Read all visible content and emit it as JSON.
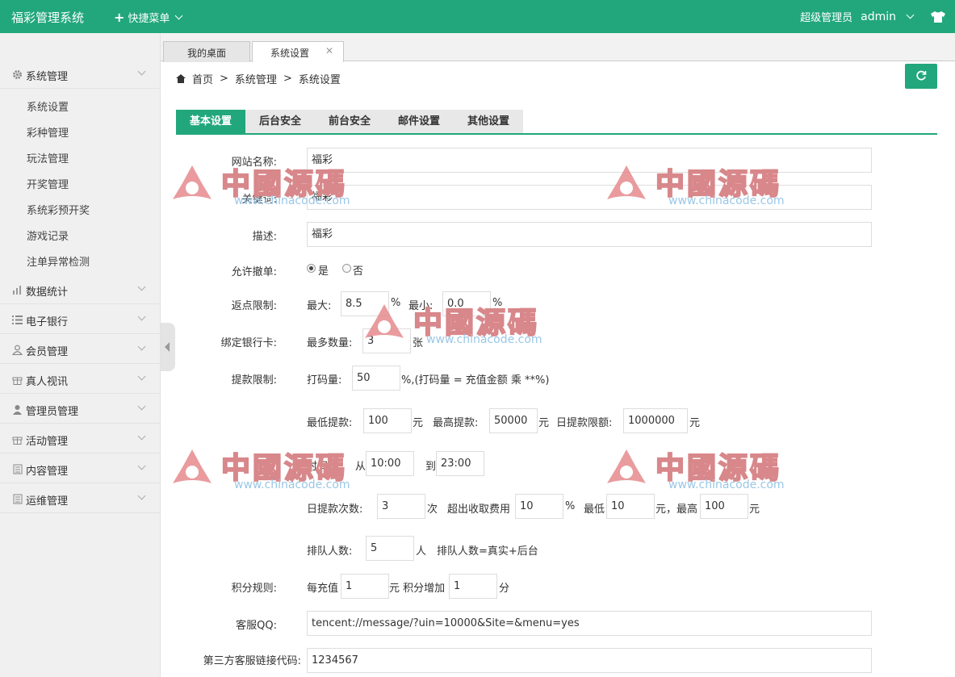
{
  "header": {
    "brand": "福彩管理系统",
    "quick_menu": "快捷菜单",
    "role": "超级管理员",
    "user": "admin",
    "theme_icon": "tshirt-icon"
  },
  "sidebar": {
    "groups": [
      {
        "label": "系统管理",
        "icon": "gear-icon"
      },
      {
        "label": "数据统计",
        "icon": "bar-chart-icon"
      },
      {
        "label": "电子银行",
        "icon": "list-icon"
      },
      {
        "label": "会员管理",
        "icon": "user-outline-icon"
      },
      {
        "label": "真人视讯",
        "icon": "gift-icon"
      },
      {
        "label": "管理员管理",
        "icon": "user-icon"
      },
      {
        "label": "活动管理",
        "icon": "gift-icon"
      },
      {
        "label": "内容管理",
        "icon": "document-icon"
      },
      {
        "label": "运维管理",
        "icon": "document-icon"
      }
    ],
    "sub_items": [
      "系统设置",
      "彩种管理",
      "玩法管理",
      "开奖管理",
      "系统彩预开奖",
      "游戏记录",
      "注单异常检测"
    ]
  },
  "tabs": [
    "我的桌面",
    "系统设置"
  ],
  "breadcrumb": {
    "home": "首页",
    "sep": ">",
    "level1": "系统管理",
    "level2": "系统设置"
  },
  "section_tabs": [
    "基本设置",
    "后台安全",
    "前台安全",
    "邮件设置",
    "其他设置"
  ],
  "form": {
    "site_name_label": "网站名称:",
    "site_name": "福彩",
    "keywords_label": "关键词:",
    "keywords": "福彩",
    "desc_label": "描述:",
    "desc": "福彩",
    "allow_cancel_label": "允许撤单:",
    "yes": "是",
    "no": "否",
    "rebate_label": "返点限制:",
    "max_label": "最大:",
    "rebate_max": "8.5",
    "percent": "%",
    "min_label": "最小:",
    "rebate_min": "0.0",
    "bind_card_label": "绑定银行卡:",
    "max_count_label": "最多数量:",
    "max_count": "3",
    "zhang": "张",
    "withdraw_label": "提款限制:",
    "bet_amount_label": "打码量:",
    "bet_amount": "50",
    "bet_note": "%,(打码量 = 充值金额 乘 **%)",
    "min_withdraw_label": "最低提款:",
    "min_withdraw": "100",
    "yuan": "元",
    "max_withdraw_label": "最高提款:",
    "max_withdraw": "50000",
    "daily_limit_label": "日提款限额:",
    "daily_limit": "1000000",
    "time_label": "时间段:",
    "from": "从",
    "time_from": "10:00",
    "to": "到",
    "time_to": "23:00",
    "daily_times_label": "日提款次数:",
    "daily_times": "3",
    "ci": "次",
    "over_fee_label": "超出收取费用",
    "over_fee": "10",
    "min_fee_label": "最低",
    "min_fee": "10",
    "max_fee_sep": "元，最高",
    "max_fee": "100",
    "queue_label": "排队人数:",
    "queue": "5",
    "ren": "人",
    "queue_note": "排队人数=真实+后台",
    "points_label": "积分规则:",
    "per_recharge": "每充值",
    "recharge": "1",
    "points_add": "元 积分增加",
    "points": "1",
    "fen": "分",
    "qq_label": "客服QQ:",
    "qq": "tencent://message/?uin=10000&Site=&menu=yes",
    "third_label": "第三方客服链接代码:",
    "third": "1234567"
  },
  "watermark": {
    "cn": "中國源碼",
    "en": "www.chinacode.com"
  }
}
